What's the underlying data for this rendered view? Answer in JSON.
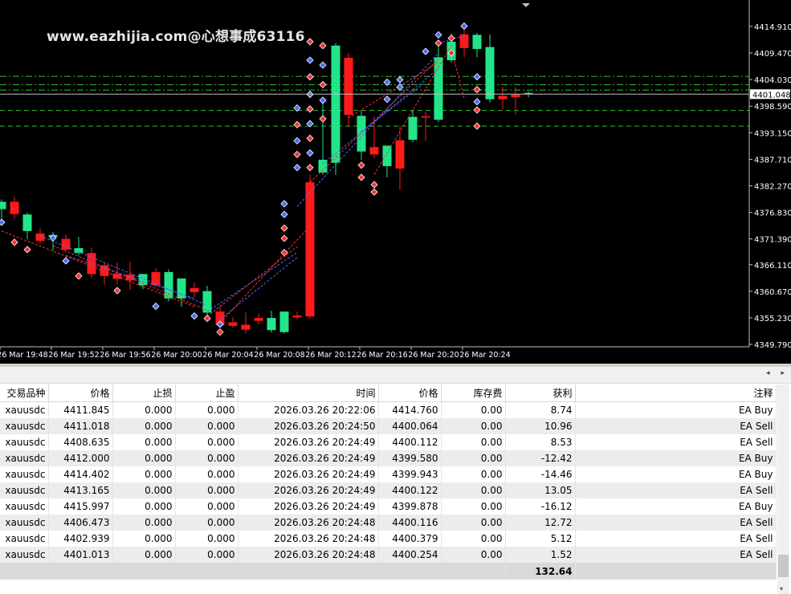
{
  "watermark": "www.eazhijia.com@心想事成63116",
  "chart_data": {
    "type": "candlestick",
    "symbol": "xauusdc",
    "current_price": "4401.048",
    "y_ticks": [
      "4414.910",
      "4409.470",
      "4404.030",
      "4398.590",
      "4393.150",
      "4387.710",
      "4382.270",
      "4376.830",
      "4371.390",
      "4366.110",
      "4360.670",
      "4355.230",
      "4349.790"
    ],
    "x_ticks": [
      "26 Mar 19:48",
      "26 Mar 19:52",
      "26 Mar 19:56",
      "26 Mar 20:00",
      "26 Mar 20:04",
      "26 Mar 20:08",
      "26 Mar 20:12",
      "26 Mar 20:16",
      "26 Mar 20:20",
      "26 Mar 20:24"
    ],
    "candles": [
      {
        "o": 4377.5,
        "h": 4379.5,
        "c": 4379.0,
        "l": 4375.0
      },
      {
        "o": 4379.0,
        "h": 4380.0,
        "c": 4376.5,
        "l": 4375.5
      },
      {
        "o": 4373.0,
        "h": 4376.8,
        "c": 4376.4,
        "l": 4371.3
      },
      {
        "o": 4372.5,
        "h": 4373.6,
        "c": 4371.0,
        "l": 4370.5
      },
      {
        "o": 4371.8,
        "h": 4372.8,
        "c": 4372.2,
        "l": 4369.0
      },
      {
        "o": 4371.4,
        "h": 4372.3,
        "c": 4369.2,
        "l": 4368.7
      },
      {
        "o": 4368.5,
        "h": 4371.8,
        "c": 4369.5,
        "l": 4368.0
      },
      {
        "o": 4368.5,
        "h": 4369.6,
        "c": 4364.2,
        "l": 4363.3
      },
      {
        "o": 4366.0,
        "h": 4366.6,
        "c": 4363.8,
        "l": 4362.0
      },
      {
        "o": 4364.3,
        "h": 4366.5,
        "c": 4363.2,
        "l": 4362.2
      },
      {
        "o": 4364.1,
        "h": 4366.7,
        "c": 4362.9,
        "l": 4361.0
      },
      {
        "o": 4361.9,
        "h": 4364.0,
        "c": 4364.2,
        "l": 4361.1
      },
      {
        "o": 4364.6,
        "h": 4365.4,
        "c": 4361.9,
        "l": 4361.5
      },
      {
        "o": 4359.2,
        "h": 4365.1,
        "c": 4364.6,
        "l": 4358.6
      },
      {
        "o": 4359.2,
        "h": 4361.2,
        "c": 4363.3,
        "l": 4357.5
      },
      {
        "o": 4361.3,
        "h": 4362.5,
        "c": 4360.5,
        "l": 4359.5
      },
      {
        "o": 4356.3,
        "h": 4361.8,
        "c": 4360.7,
        "l": 4355.4
      },
      {
        "o": 4356.5,
        "h": 4357.7,
        "c": 4353.7,
        "l": 4353.5
      },
      {
        "o": 4354.3,
        "h": 4355.4,
        "c": 4353.6,
        "l": 4353.2
      },
      {
        "o": 4353.8,
        "h": 4356.3,
        "c": 4352.8,
        "l": 4352.0
      },
      {
        "o": 4355.2,
        "h": 4356.1,
        "c": 4354.6,
        "l": 4353.8
      },
      {
        "o": 4352.7,
        "h": 4356.7,
        "c": 4355.2,
        "l": 4352.2
      },
      {
        "o": 4352.3,
        "h": 4356.5,
        "c": 4356.5,
        "l": 4352.0
      },
      {
        "o": 4355.7,
        "h": 4356.5,
        "c": 4355.3,
        "l": 4354.9
      },
      {
        "o": 4383.0,
        "h": 4384.5,
        "c": 4355.5,
        "l": 4355.0
      },
      {
        "o": 4385.0,
        "h": 4399.5,
        "c": 4387.6,
        "l": 4384.5
      },
      {
        "o": 4387.0,
        "h": 4411.5,
        "c": 4411.0,
        "l": 4384.5
      },
      {
        "o": 4408.5,
        "h": 4409.5,
        "c": 4396.8,
        "l": 4394.5
      },
      {
        "o": 4389.3,
        "h": 4397.6,
        "c": 4396.6,
        "l": 4387.6
      },
      {
        "o": 4390.2,
        "h": 4396.5,
        "c": 4388.7,
        "l": 4388.0
      },
      {
        "o": 4386.3,
        "h": 4390.3,
        "c": 4390.5,
        "l": 4384.0
      },
      {
        "o": 4391.6,
        "h": 4394.6,
        "c": 4385.8,
        "l": 4381.5
      },
      {
        "o": 4391.7,
        "h": 4397.6,
        "c": 4396.4,
        "l": 4391.2
      },
      {
        "o": 4396.5,
        "h": 4397.5,
        "c": 4396.3,
        "l": 4391.5
      },
      {
        "o": 4395.8,
        "h": 4411.0,
        "c": 4408.6,
        "l": 4395.3
      },
      {
        "o": 4408.0,
        "h": 4413.5,
        "c": 4411.8,
        "l": 4407.5
      },
      {
        "o": 4413.3,
        "h": 4414.9,
        "c": 4410.5,
        "l": 4408.6
      },
      {
        "o": 4410.3,
        "h": 4413.6,
        "c": 4413.2,
        "l": 4408.6
      },
      {
        "o": 4400.0,
        "h": 4413.3,
        "c": 4410.7,
        "l": 4399.3
      },
      {
        "o": 4400.7,
        "h": 4402.6,
        "c": 4400.0,
        "l": 4398.0
      },
      {
        "o": 4401.0,
        "h": 4402.5,
        "c": 4400.4,
        "l": 4396.9
      },
      {
        "o": 4401.0,
        "h": 4401.6,
        "c": 4401.3,
        "l": 4400.4
      }
    ],
    "h_lines": [
      {
        "price": 4404.7,
        "style": "dashdot"
      },
      {
        "price": 4403.0,
        "style": "dashdot"
      },
      {
        "price": 4401.9,
        "style": "dashdot"
      },
      {
        "price": 4397.7,
        "style": "dash"
      },
      {
        "price": 4394.5,
        "style": "dash"
      }
    ]
  },
  "table": {
    "headers": [
      "交易品种",
      "价格",
      "止损",
      "止盈",
      "时间",
      "价格",
      "库存费",
      "获利",
      "注释"
    ],
    "rows": [
      [
        "xauusdc",
        "4411.845",
        "0.000",
        "0.000",
        "2026.03.26 20:22:06",
        "4414.760",
        "0.00",
        "8.74",
        "EA Buy"
      ],
      [
        "xauusdc",
        "4411.018",
        "0.000",
        "0.000",
        "2026.03.26 20:24:50",
        "4400.064",
        "0.00",
        "10.96",
        "EA Sell"
      ],
      [
        "xauusdc",
        "4408.635",
        "0.000",
        "0.000",
        "2026.03.26 20:24:49",
        "4400.112",
        "0.00",
        "8.53",
        "EA Sell"
      ],
      [
        "xauusdc",
        "4412.000",
        "0.000",
        "0.000",
        "2026.03.26 20:24:49",
        "4399.580",
        "0.00",
        "-12.42",
        "EA Buy"
      ],
      [
        "xauusdc",
        "4414.402",
        "0.000",
        "0.000",
        "2026.03.26 20:24:49",
        "4399.943",
        "0.00",
        "-14.46",
        "EA Buy"
      ],
      [
        "xauusdc",
        "4413.165",
        "0.000",
        "0.000",
        "2026.03.26 20:24:49",
        "4400.122",
        "0.00",
        "13.05",
        "EA Sell"
      ],
      [
        "xauusdc",
        "4415.997",
        "0.000",
        "0.000",
        "2026.03.26 20:24:49",
        "4399.878",
        "0.00",
        "-16.12",
        "EA Buy"
      ],
      [
        "xauusdc",
        "4406.473",
        "0.000",
        "0.000",
        "2026.03.26 20:24:48",
        "4400.116",
        "0.00",
        "12.72",
        "EA Sell"
      ],
      [
        "xauusdc",
        "4402.939",
        "0.000",
        "0.000",
        "2026.03.26 20:24:48",
        "4400.379",
        "0.00",
        "5.12",
        "EA Sell"
      ],
      [
        "xauusdc",
        "4401.013",
        "0.000",
        "0.000",
        "2026.03.26 20:24:48",
        "4400.254",
        "0.00",
        "1.52",
        "EA Sell"
      ]
    ],
    "total_profit": "132.64"
  },
  "colors": {
    "bull": "#22e58a",
    "bear": "#ff1a1a",
    "grid_line": "#2fbf2f",
    "current_line": "#c0c0c0",
    "trade_blue": "#4a6cff",
    "trade_red": "#ff3030"
  },
  "icons": {
    "scroll_left": "◂",
    "scroll_right": "▸",
    "scroll_down": "▾",
    "top_marker": "▾"
  }
}
